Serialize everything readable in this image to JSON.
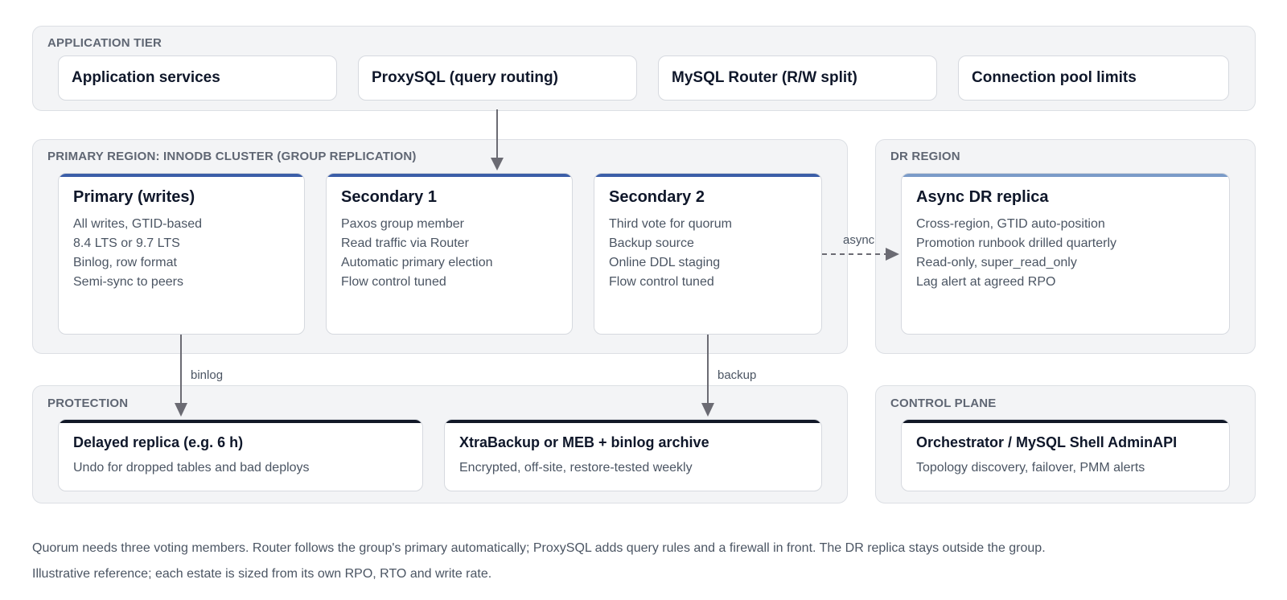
{
  "tiers": {
    "application": {
      "label": "APPLICATION TIER",
      "boxes": [
        "Application services",
        "ProxySQL (query routing)",
        "MySQL Router (R/W split)",
        "Connection pool limits"
      ]
    },
    "primary_region": {
      "label": "PRIMARY REGION: INNODB CLUSTER (GROUP REPLICATION)",
      "nodes": [
        {
          "title": "Primary (writes)",
          "lines": [
            "All writes, GTID-based",
            "8.4 LTS or 9.7 LTS",
            "Binlog, row format",
            "Semi-sync to peers"
          ]
        },
        {
          "title": "Secondary 1",
          "lines": [
            "Paxos group member",
            "Read traffic via Router",
            "Automatic primary election",
            "Flow control tuned"
          ]
        },
        {
          "title": "Secondary 2",
          "lines": [
            "Third vote for quorum",
            "Backup source",
            "Online DDL staging",
            "Flow control tuned"
          ]
        }
      ]
    },
    "dr_region": {
      "label": "DR REGION",
      "node": {
        "title": "Async DR replica",
        "lines": [
          "Cross-region, GTID auto-position",
          "Promotion runbook drilled quarterly",
          "Read-only, super_read_only",
          "Lag alert at agreed RPO"
        ]
      }
    },
    "protection": {
      "label": "PROTECTION",
      "nodes": [
        {
          "title": "Delayed replica (e.g. 6 h)",
          "detail": "Undo for dropped tables and bad deploys"
        },
        {
          "title": "XtraBackup or MEB + binlog archive",
          "detail": "Encrypted, off-site, restore-tested weekly"
        }
      ]
    },
    "control_plane": {
      "label": "CONTROL PLANE",
      "node": {
        "title": "Orchestrator / MySQL Shell AdminAPI",
        "detail": "Topology discovery, failover, PMM alerts"
      }
    }
  },
  "edges": {
    "binlog": "binlog",
    "backup": "backup",
    "async": "async"
  },
  "footer": {
    "note": "Quorum needs three voting members. Router follows the group's primary automatically; ProxySQL adds query rules and a firewall in front. The DR replica stays outside the group.",
    "disclaimer": "Illustrative reference; each estate is sized from its own RPO, RTO and write rate."
  },
  "colors": {
    "cluster_accent": "#3b5ea8",
    "dr_accent": "#7a9bc8",
    "protection_accent": "#111827",
    "arrow": "#6b6b73"
  }
}
